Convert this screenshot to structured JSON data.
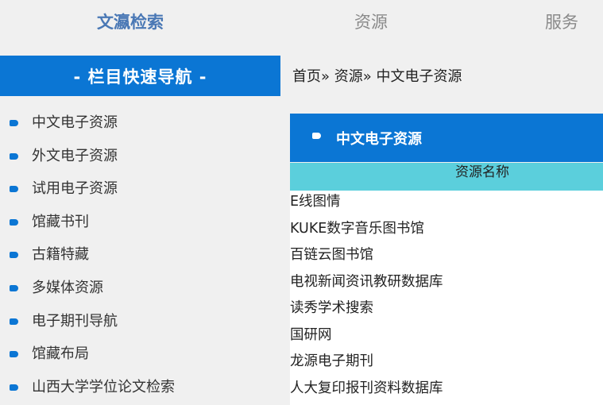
{
  "topnav": {
    "items": [
      "文瀛检索",
      "资源",
      "服务"
    ]
  },
  "sidebar": {
    "header": "- 栏目快速导航 -",
    "items": [
      "中文电子资源",
      "外文电子资源",
      "试用电子资源",
      "馆藏书刊",
      "古籍特藏",
      "多媒体资源",
      "电子期刊导航",
      "馆藏布局",
      "山西大学学位论文检索"
    ]
  },
  "breadcrumb": {
    "home": "首页",
    "sep": "»",
    "level1": "资源",
    "current": "中文电子资源"
  },
  "panel": {
    "title": "中文电子资源",
    "column_header": "资源名称",
    "resources": [
      "E线图情",
      "KUKE数字音乐图书馆",
      "百链云图书馆",
      "电视新闻资讯教研数据库",
      "读秀学术搜索",
      "国研网",
      "龙源电子期刊",
      "人大复印报刊资料数据库"
    ]
  },
  "colors": {
    "primary": "#0b76d4",
    "column_header": "#5bcfdc",
    "active_nav": "#4a78b5",
    "nav": "#8a8a8a"
  },
  "icons": {
    "list_bullet": "tag-icon"
  }
}
